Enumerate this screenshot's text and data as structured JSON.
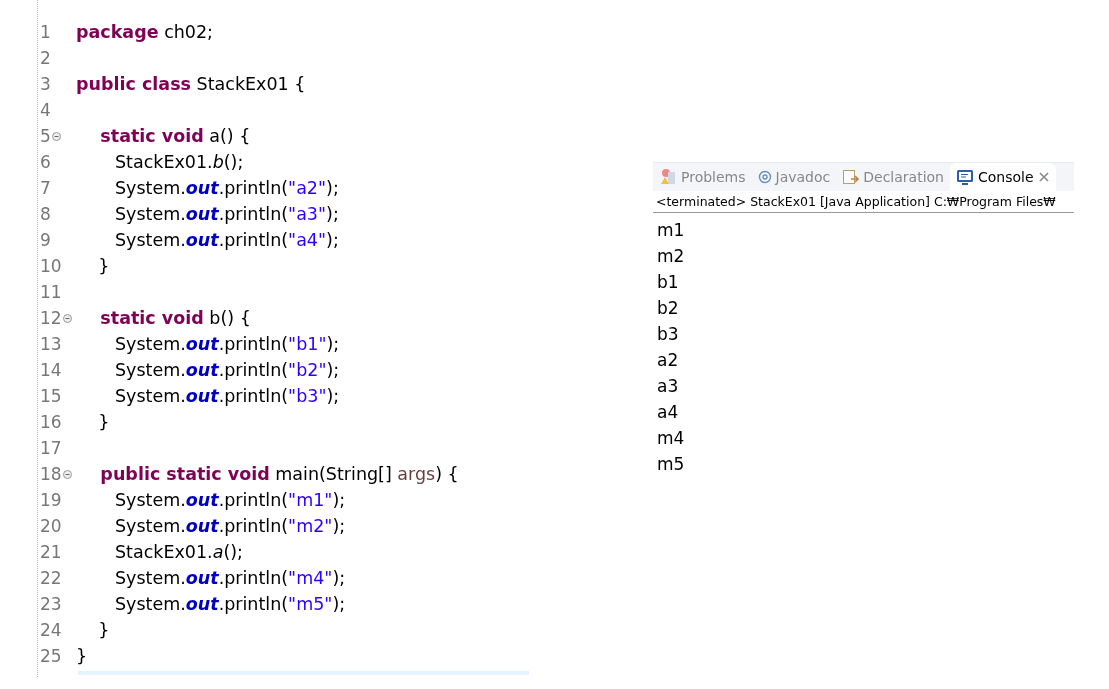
{
  "editor": {
    "lines": [
      {
        "number": "1",
        "foldable": false,
        "tokens": [
          {
            "kind": "keyword",
            "text": "package"
          },
          {
            "kind": "plain",
            "text": " ch02;"
          }
        ]
      },
      {
        "number": "2",
        "foldable": false
      },
      {
        "number": "3",
        "foldable": false,
        "tokens": [
          {
            "kind": "keyword",
            "text": "public class"
          },
          {
            "kind": "plain",
            "text": " StackEx01 {"
          }
        ]
      },
      {
        "number": "4",
        "foldable": false
      },
      {
        "number": "5",
        "foldable": true,
        "tokens": [
          {
            "kind": "keyword",
            "text": "    static void"
          },
          {
            "kind": "plain",
            "text": " a() {"
          }
        ]
      },
      {
        "number": "6",
        "foldable": false,
        "tokens": [
          {
            "kind": "plain",
            "text": "       StackEx01."
          },
          {
            "kind": "static-call",
            "text": "b"
          },
          {
            "kind": "plain",
            "text": "();"
          }
        ]
      },
      {
        "number": "7",
        "foldable": false,
        "tokens": [
          {
            "kind": "plain",
            "text": "       System."
          },
          {
            "kind": "field",
            "text": "out"
          },
          {
            "kind": "plain",
            "text": ".println("
          },
          {
            "kind": "string",
            "text": "\"a2\""
          },
          {
            "kind": "plain",
            "text": ");"
          }
        ]
      },
      {
        "number": "8",
        "foldable": false,
        "tokens": [
          {
            "kind": "plain",
            "text": "       System."
          },
          {
            "kind": "field",
            "text": "out"
          },
          {
            "kind": "plain",
            "text": ".println("
          },
          {
            "kind": "string",
            "text": "\"a3\""
          },
          {
            "kind": "plain",
            "text": ");"
          }
        ]
      },
      {
        "number": "9",
        "foldable": false,
        "tokens": [
          {
            "kind": "plain",
            "text": "       System."
          },
          {
            "kind": "field",
            "text": "out"
          },
          {
            "kind": "plain",
            "text": ".println("
          },
          {
            "kind": "string",
            "text": "\"a4\""
          },
          {
            "kind": "plain",
            "text": ");"
          }
        ]
      },
      {
        "number": "10",
        "foldable": false,
        "tokens": [
          {
            "kind": "plain",
            "text": "    }"
          }
        ]
      },
      {
        "number": "11",
        "foldable": false
      },
      {
        "number": "12",
        "foldable": true,
        "tokens": [
          {
            "kind": "keyword",
            "text": "    static void"
          },
          {
            "kind": "plain",
            "text": " b() {"
          }
        ]
      },
      {
        "number": "13",
        "foldable": false,
        "tokens": [
          {
            "kind": "plain",
            "text": "       System."
          },
          {
            "kind": "field",
            "text": "out"
          },
          {
            "kind": "plain",
            "text": ".println("
          },
          {
            "kind": "string",
            "text": "\"b1\""
          },
          {
            "kind": "plain",
            "text": ");"
          }
        ]
      },
      {
        "number": "14",
        "foldable": false,
        "tokens": [
          {
            "kind": "plain",
            "text": "       System."
          },
          {
            "kind": "field",
            "text": "out"
          },
          {
            "kind": "plain",
            "text": ".println("
          },
          {
            "kind": "string",
            "text": "\"b2\""
          },
          {
            "kind": "plain",
            "text": ");"
          }
        ]
      },
      {
        "number": "15",
        "foldable": false,
        "tokens": [
          {
            "kind": "plain",
            "text": "       System."
          },
          {
            "kind": "field",
            "text": "out"
          },
          {
            "kind": "plain",
            "text": ".println("
          },
          {
            "kind": "string",
            "text": "\"b3\""
          },
          {
            "kind": "plain",
            "text": ");"
          }
        ]
      },
      {
        "number": "16",
        "foldable": false,
        "tokens": [
          {
            "kind": "plain",
            "text": "    }"
          }
        ]
      },
      {
        "number": "17",
        "foldable": false
      },
      {
        "number": "18",
        "foldable": true,
        "tokens": [
          {
            "kind": "keyword",
            "text": "    public static void"
          },
          {
            "kind": "plain",
            "text": " main(String[] "
          },
          {
            "kind": "param",
            "text": "args"
          },
          {
            "kind": "plain",
            "text": ") {"
          }
        ]
      },
      {
        "number": "19",
        "foldable": false,
        "tokens": [
          {
            "kind": "plain",
            "text": "       System."
          },
          {
            "kind": "field",
            "text": "out"
          },
          {
            "kind": "plain",
            "text": ".println("
          },
          {
            "kind": "string",
            "text": "\"m1\""
          },
          {
            "kind": "plain",
            "text": ");"
          }
        ]
      },
      {
        "number": "20",
        "foldable": false,
        "tokens": [
          {
            "kind": "plain",
            "text": "       System."
          },
          {
            "kind": "field",
            "text": "out"
          },
          {
            "kind": "plain",
            "text": ".println("
          },
          {
            "kind": "string",
            "text": "\"m2\""
          },
          {
            "kind": "plain",
            "text": ");"
          }
        ]
      },
      {
        "number": "21",
        "foldable": false,
        "tokens": [
          {
            "kind": "plain",
            "text": "       StackEx01."
          },
          {
            "kind": "static-call",
            "text": "a"
          },
          {
            "kind": "plain",
            "text": "();"
          }
        ]
      },
      {
        "number": "22",
        "foldable": false,
        "tokens": [
          {
            "kind": "plain",
            "text": "       System."
          },
          {
            "kind": "field",
            "text": "out"
          },
          {
            "kind": "plain",
            "text": ".println("
          },
          {
            "kind": "string",
            "text": "\"m4\""
          },
          {
            "kind": "plain",
            "text": ");"
          }
        ]
      },
      {
        "number": "23",
        "foldable": false,
        "tokens": [
          {
            "kind": "plain",
            "text": "       System."
          },
          {
            "kind": "field",
            "text": "out"
          },
          {
            "kind": "plain",
            "text": ".println("
          },
          {
            "kind": "string",
            "text": "\"m5\""
          },
          {
            "kind": "plain",
            "text": ");"
          }
        ]
      },
      {
        "number": "24",
        "foldable": false,
        "tokens": [
          {
            "kind": "plain",
            "text": "    }"
          }
        ]
      },
      {
        "number": "25",
        "foldable": false,
        "tokens": [
          {
            "kind": "plain",
            "text": "}"
          }
        ]
      }
    ]
  },
  "console": {
    "tabs": [
      {
        "kind": "problems",
        "label": "Problems",
        "selected": false
      },
      {
        "kind": "javadoc",
        "label": "Javadoc",
        "selected": false
      },
      {
        "kind": "declaration",
        "label": "Declaration",
        "selected": false
      },
      {
        "kind": "console",
        "label": "Console",
        "selected": true
      }
    ],
    "header": "<terminated> StackEx01 [Java Application] C:₩Program Files₩",
    "output": [
      "m1",
      "m2",
      "b1",
      "b2",
      "b3",
      "a2",
      "a3",
      "a4",
      "m4",
      "m5"
    ]
  }
}
